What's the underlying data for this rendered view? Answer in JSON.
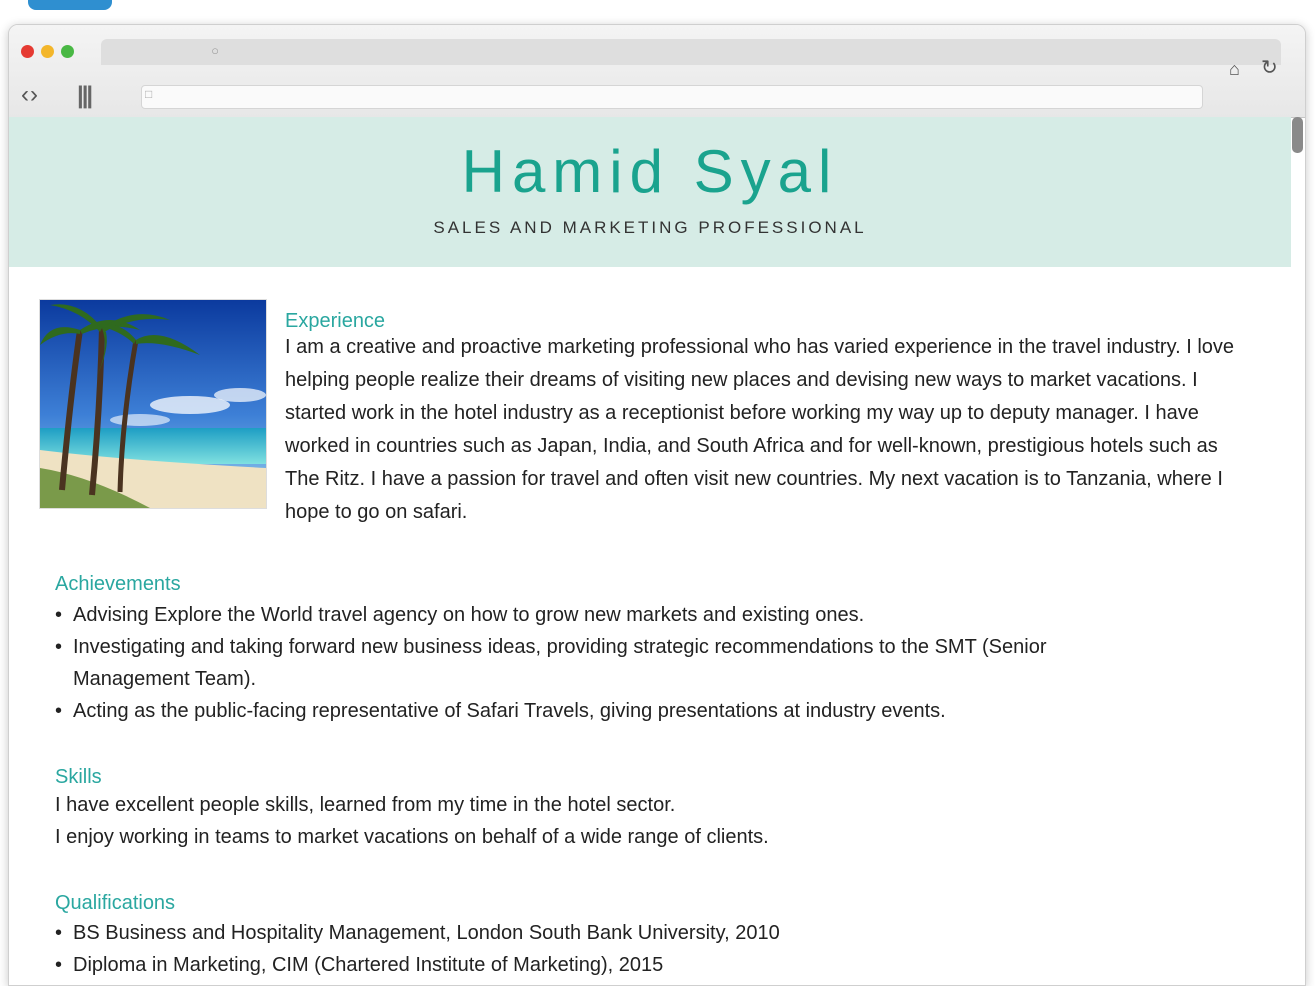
{
  "browser": {
    "home_icon": "house-icon",
    "reload_icon": "reload-icon",
    "nav_icon": "back-forward-icon",
    "bookmarks_icon": "bookmarks-icon"
  },
  "header": {
    "name": "Hamid Syal",
    "tagline": "SALES AND MARKETING PROFESSIONAL"
  },
  "photo": {
    "alt": "Tropical beach with palm trees"
  },
  "experience": {
    "title": "Experience",
    "body": "I am a creative and proactive marketing professional who has varied experience in the travel industry. I love helping people realize their dreams of visiting new places and devising new ways to market vacations. I started work in the hotel industry as a receptionist before working my way up to deputy manager. I have worked in countries such as Japan, India, and South Africa and for well-known, prestigious hotels such as The Ritz. I have a passion for travel and often visit new countries. My next vacation is to Tanzania, where I hope to go on safari."
  },
  "achievements": {
    "title": "Achievements",
    "items": [
      "Advising Explore the World travel agency on how to grow new markets and existing ones.",
      "Investigating and taking forward new business ideas, providing strategic recommendations to the SMT (Senior Management Team).",
      "Acting as the public-facing representative of Safari Travels, giving presentations at industry events."
    ]
  },
  "skills": {
    "title": "Skills",
    "lines": [
      "I have excellent people skills, learned from my time in the hotel sector.",
      "I enjoy working in teams to market vacations on behalf of a wide range of clients."
    ]
  },
  "qualifications": {
    "title": "Qualifications",
    "items": [
      "BS Business and Hospitality Management, London South Bank University, 2010",
      "Diploma in Marketing, CIM (Chartered Institute of Marketing), 2015"
    ]
  },
  "colors": {
    "accent": "#1aa38e",
    "header_band": "#d6ece6",
    "section_title": "#2aa7a0"
  }
}
